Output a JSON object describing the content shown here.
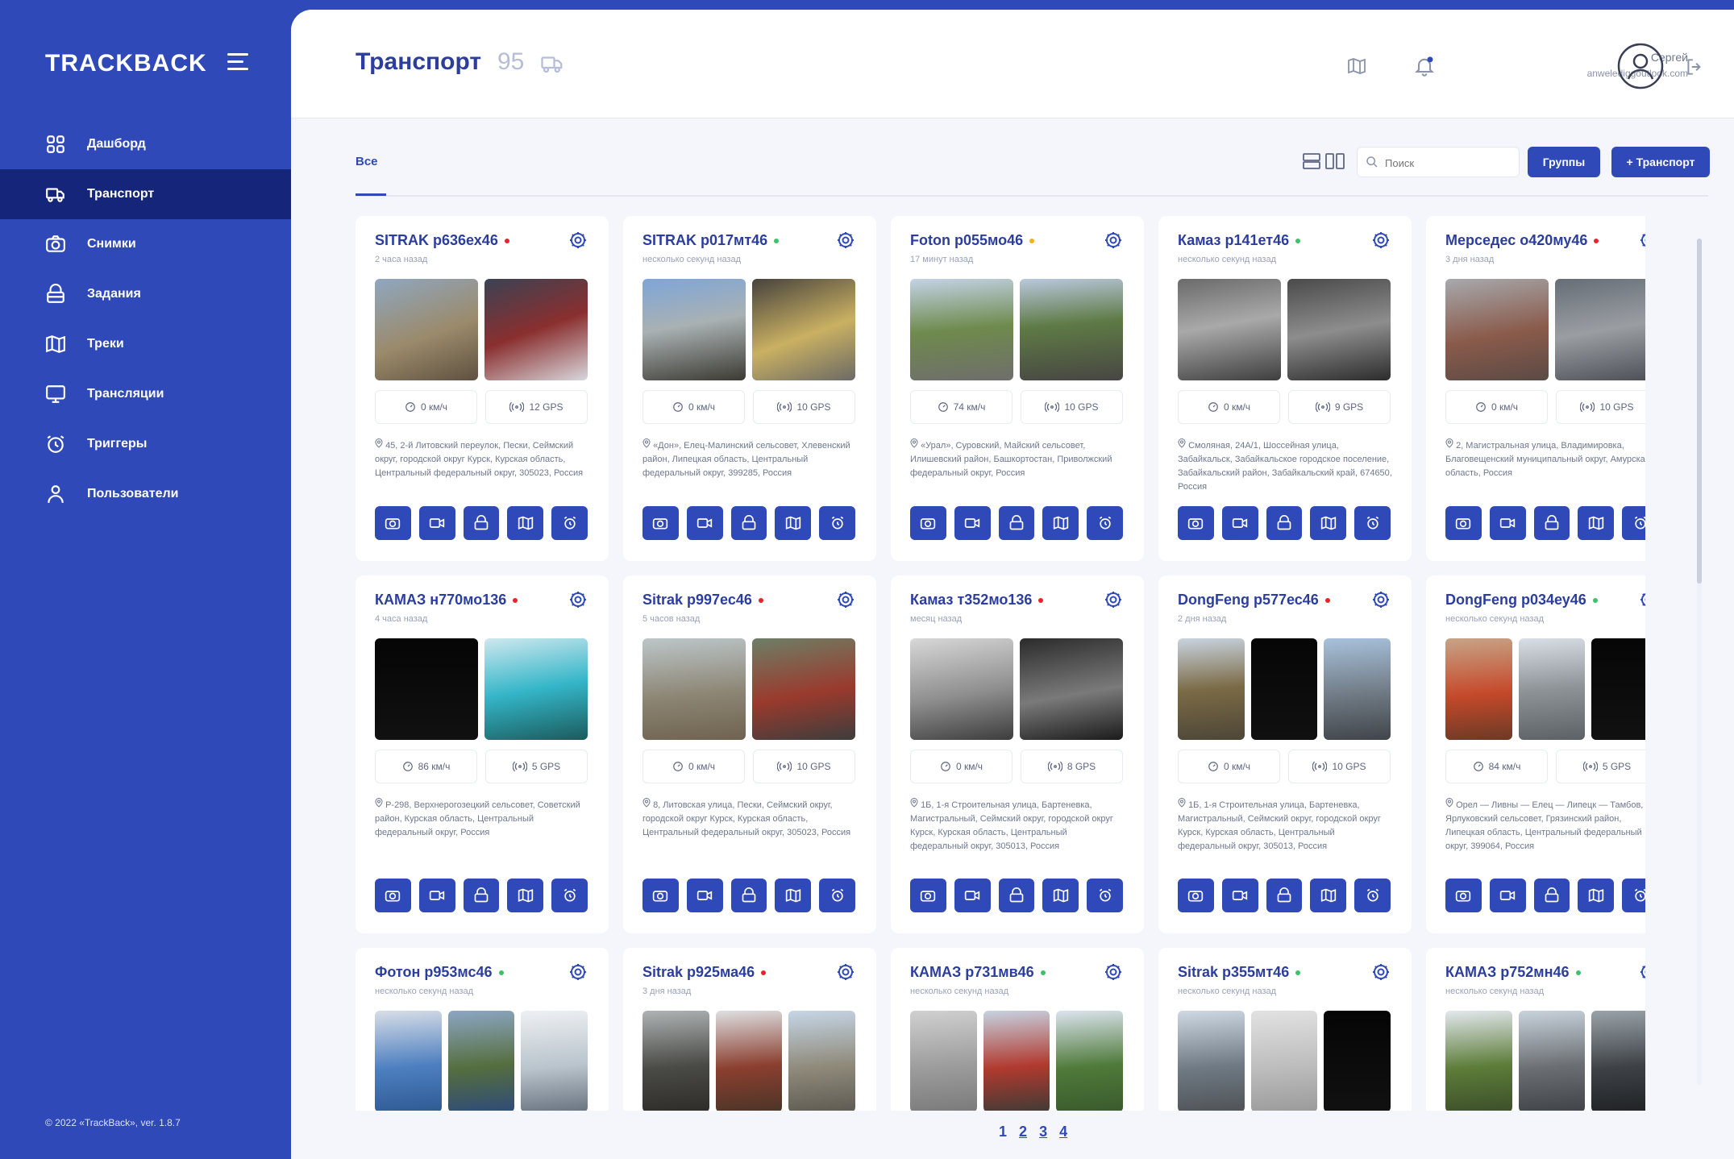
{
  "app": {
    "logo": "TRACKBACK",
    "copyright": "© 2022 «TrackBack», ver. 1.8.7"
  },
  "sidebar": {
    "items": [
      {
        "label": "Дашборд",
        "icon": "dashboard-icon"
      },
      {
        "label": "Транспорт",
        "icon": "truck-icon",
        "active": true
      },
      {
        "label": "Снимки",
        "icon": "camera-icon"
      },
      {
        "label": "Задания",
        "icon": "tasks-icon"
      },
      {
        "label": "Треки",
        "icon": "map-icon"
      },
      {
        "label": "Трансляции",
        "icon": "monitor-icon"
      },
      {
        "label": "Триггеры",
        "icon": "alarm-icon"
      },
      {
        "label": "Пользователи",
        "icon": "user-icon"
      }
    ]
  },
  "header": {
    "title": "Транспорт",
    "count": "95",
    "user_name": "Сергей",
    "user_email": "anwelediggoutlook.com"
  },
  "toolbar": {
    "tab_all": "Все",
    "search_placeholder": "Поиск",
    "groups_label": "Группы",
    "add_label": "+ Транспорт"
  },
  "colors": {
    "accent": "#2f49b8",
    "active_nav": "#15267a",
    "status_red": "#e5242d",
    "status_green": "#3cc36a",
    "status_yellow": "#f2b21a"
  },
  "vehicles": [
    {
      "name": "SITRAK р636ех46",
      "status": "red",
      "time": "2 часа назад",
      "speed": "0 км/ч",
      "gps": "12 GPS",
      "address": "45, 2-й Литовский переулок, Пески, Сеймский округ, городской округ Курск, Курская область, Центральный федеральный округ, 305023, Россия"
    },
    {
      "name": "SITRAK р017мт46",
      "status": "green",
      "time": "несколько секунд назад",
      "speed": "0 км/ч",
      "gps": "10 GPS",
      "address": "«Дон», Елец-Малинский сельсовет, Хлевенский район, Липецкая область, Центральный федеральный округ, 399285, Россия"
    },
    {
      "name": "Foton р055мо46",
      "status": "yellow",
      "time": "17 минут назад",
      "speed": "74 км/ч",
      "gps": "10 GPS",
      "address": "«Урал», Суровский, Майский сельсовет, Илишевский район, Башкортостан, Приволжский федеральный округ, Россия"
    },
    {
      "name": "Камаз р141ет46",
      "status": "green",
      "time": "несколько секунд назад",
      "speed": "0 км/ч",
      "gps": "9 GPS",
      "address": "Смоляная, 24А/1, Шоссейная улица, Забайкальск, Забайкальское городское поселение, Забайкальский район, Забайкальский край, 674650, Россия"
    },
    {
      "name": "Мерседес о420му46",
      "status": "red",
      "time": "3 дня назад",
      "speed": "0 км/ч",
      "gps": "10 GPS",
      "address": "2, Магистральная улица, Владимировка, Благовещенский муниципальный округ, Амурская область, Россия"
    },
    {
      "name": "КАМАЗ н770мо136",
      "status": "red",
      "time": "4 часа назад",
      "speed": "86 км/ч",
      "gps": "5 GPS",
      "address": "Р-298, Верхнерогозецкий сельсовет, Советский район, Курская область, Центральный федеральный округ, Россия"
    },
    {
      "name": "Sitrak р997ес46",
      "status": "red",
      "time": "5 часов назад",
      "speed": "0 км/ч",
      "gps": "10 GPS",
      "address": "8, Литовская улица, Пески, Сеймский округ, городской округ Курск, Курская область, Центральный федеральный округ, 305023, Россия"
    },
    {
      "name": "Камаз т352мо136",
      "status": "red",
      "time": "месяц назад",
      "speed": "0 км/ч",
      "gps": "8 GPS",
      "address": "1Б, 1-я Строительная улица, Бартеневка, Магистральный, Сеймский округ, городской округ Курск, Курская область, Центральный федеральный округ, 305013, Россия"
    },
    {
      "name": "DongFeng р577ес46",
      "status": "red",
      "time": "2 дня назад",
      "speed": "0 км/ч",
      "gps": "10 GPS",
      "address": "1Б, 1-я Строительная улица, Бартеневка, Магистральный, Сеймский округ, городской округ Курск, Курская область, Центральный федеральный округ, 305013, Россия"
    },
    {
      "name": "DongFeng р034еу46",
      "status": "green",
      "time": "несколько секунд назад",
      "speed": "84 км/ч",
      "gps": "5 GPS",
      "address": "Орел — Ливны — Елец — Липецк — Тамбов, Ярлуковский сельсовет, Грязинский район, Липецкая область, Центральный федеральный округ, 399064, Россия"
    },
    {
      "name": "Фотон р953мс46",
      "status": "green",
      "time": "несколько секунд назад"
    },
    {
      "name": "Sitrak р925ма46",
      "status": "red",
      "time": "3 дня назад"
    },
    {
      "name": "КАМАЗ р731мв46",
      "status": "green",
      "time": "несколько секунд назад"
    },
    {
      "name": "Sitrak р355мт46",
      "status": "green",
      "time": "несколько секунд назад"
    },
    {
      "name": "КАМАЗ р752мн46",
      "status": "green",
      "time": "несколько секунд назад"
    }
  ],
  "pagination": {
    "pages": [
      "1",
      "2",
      "3",
      "4"
    ]
  }
}
